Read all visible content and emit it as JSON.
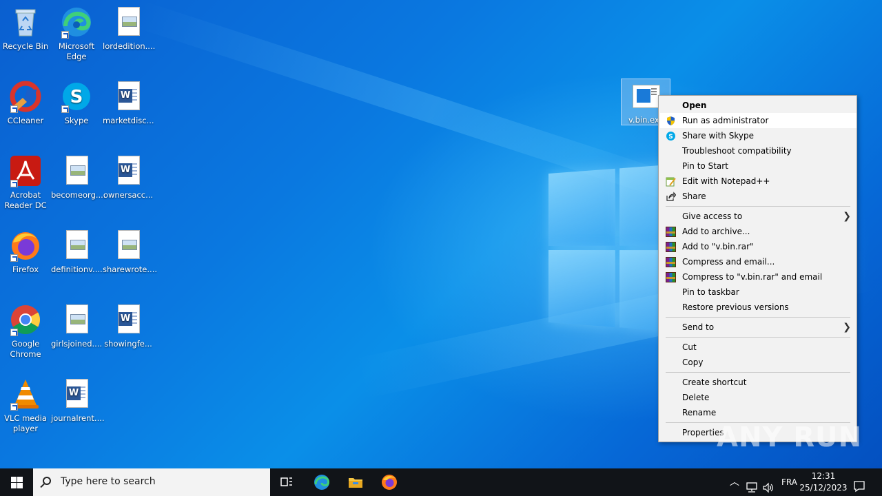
{
  "desktop_icons": [
    {
      "label": "Recycle Bin",
      "icon": "recycle-bin-icon"
    },
    {
      "label": "Microsoft Edge",
      "icon": "edge-icon"
    },
    {
      "label": "lordedition....",
      "icon": "image-file-icon"
    },
    {
      "label": "CCleaner",
      "icon": "ccleaner-icon"
    },
    {
      "label": "Skype",
      "icon": "skype-icon"
    },
    {
      "label": "marketdisc...",
      "icon": "word-document-icon"
    },
    {
      "label": "Acrobat Reader DC",
      "icon": "acrobat-icon"
    },
    {
      "label": "becomeorg....",
      "icon": "image-file-icon"
    },
    {
      "label": "ownersacc...",
      "icon": "word-document-icon"
    },
    {
      "label": "Firefox",
      "icon": "firefox-icon"
    },
    {
      "label": "definitionv....",
      "icon": "image-file-icon"
    },
    {
      "label": "sharewrote....",
      "icon": "image-file-icon"
    },
    {
      "label": "Google Chrome",
      "icon": "chrome-icon"
    },
    {
      "label": "girlsjoined....",
      "icon": "image-file-icon"
    },
    {
      "label": "showingfe...",
      "icon": "word-document-icon"
    },
    {
      "label": "VLC media player",
      "icon": "vlc-icon"
    },
    {
      "label": "journalrent....",
      "icon": "word-document-icon"
    }
  ],
  "selected_file": {
    "label": "v.bin.ex",
    "icon": "executable-file-icon"
  },
  "context_menu": {
    "items": [
      {
        "label": "Open",
        "icon": ""
      },
      {
        "label": "Run as administrator",
        "icon": "uac-shield-icon"
      },
      {
        "label": "Share with Skype",
        "icon": "skype-icon"
      },
      {
        "label": "Troubleshoot compatibility",
        "icon": ""
      },
      {
        "label": "Pin to Start",
        "icon": ""
      },
      {
        "label": "Edit with Notepad++",
        "icon": "notepad-plus-plus-icon"
      },
      {
        "label": "Share",
        "icon": "share-icon"
      },
      {
        "label": "Give access to",
        "icon": "",
        "submenu": true
      },
      {
        "label": "Add to archive...",
        "icon": "winrar-icon"
      },
      {
        "label": "Add to \"v.bin.rar\"",
        "icon": "winrar-icon"
      },
      {
        "label": "Compress and email...",
        "icon": "winrar-icon"
      },
      {
        "label": "Compress to \"v.bin.rar\" and email",
        "icon": "winrar-icon"
      },
      {
        "label": "Pin to taskbar",
        "icon": ""
      },
      {
        "label": "Restore previous versions",
        "icon": ""
      },
      {
        "label": "Send to",
        "icon": "",
        "submenu": true
      },
      {
        "label": "Cut",
        "icon": ""
      },
      {
        "label": "Copy",
        "icon": ""
      },
      {
        "label": "Create shortcut",
        "icon": ""
      },
      {
        "label": "Delete",
        "icon": ""
      },
      {
        "label": "Rename",
        "icon": ""
      },
      {
        "label": "Properties",
        "icon": ""
      }
    ],
    "highlighted": "Run as administrator"
  },
  "watermark": "ANY RUN",
  "taskbar": {
    "search_placeholder": "Type here to search",
    "pinned": [
      "task-view-icon",
      "edge-icon",
      "file-explorer-icon",
      "firefox-icon"
    ],
    "tray": {
      "language": "FRA",
      "time": "12:31",
      "date": "25/12/2023",
      "icons": [
        "chevron-up-icon",
        "network-icon",
        "volume-icon",
        "notification-icon"
      ]
    }
  },
  "colors": {
    "desktop_blue": "#0a78e0",
    "taskbar": "#111418",
    "menu_bg": "#f2f2f2",
    "menu_highlight": "#ffffff"
  }
}
